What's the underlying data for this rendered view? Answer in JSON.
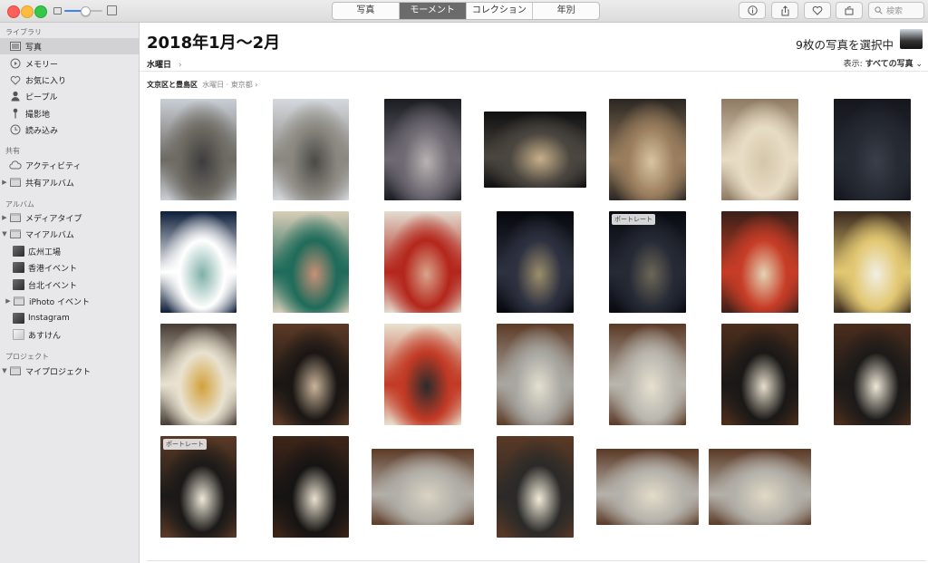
{
  "toolbar": {
    "tabs": [
      {
        "label": "写真",
        "active": false
      },
      {
        "label": "モーメント",
        "active": true
      },
      {
        "label": "コレクション",
        "active": false
      },
      {
        "label": "年別",
        "active": false
      }
    ],
    "search_placeholder": "検索",
    "zoom_level": 0.55,
    "buttons": [
      "info-icon",
      "share-icon",
      "heart-icon",
      "rotate-icon"
    ]
  },
  "sidebar": {
    "sections": [
      {
        "title": "ライブラリ",
        "items": [
          {
            "label": "写真",
            "icon": "photos-icon",
            "selected": true
          },
          {
            "label": "メモリー",
            "icon": "memories-icon"
          },
          {
            "label": "お気に入り",
            "icon": "heart-icon"
          },
          {
            "label": "ピープル",
            "icon": "person-icon"
          },
          {
            "label": "撮影地",
            "icon": "pin-icon"
          },
          {
            "label": "読み込み",
            "icon": "clock-icon"
          }
        ]
      },
      {
        "title": "共有",
        "items": [
          {
            "label": "アクティビティ",
            "icon": "cloud-icon"
          },
          {
            "label": "共有アルバム",
            "icon": "folder-icon",
            "expandable": true
          }
        ]
      },
      {
        "title": "アルバム",
        "items": [
          {
            "label": "メディアタイプ",
            "icon": "folder-icon",
            "expandable": true
          },
          {
            "label": "マイアルバム",
            "icon": "folder-icon",
            "expanded": true
          },
          {
            "label": "広州工場",
            "icon": "album-thumb"
          },
          {
            "label": "香港イベント",
            "icon": "album-thumb"
          },
          {
            "label": "台北イベント",
            "icon": "album-thumb"
          },
          {
            "label": "iPhoto イベント",
            "icon": "folder-icon",
            "expandable": true
          },
          {
            "label": "Instagram",
            "icon": "album-thumb"
          },
          {
            "label": "あすけん",
            "icon": "album-thumb-light"
          }
        ]
      },
      {
        "title": "プロジェクト",
        "items": [
          {
            "label": "マイプロジェクト",
            "icon": "folder-icon",
            "expanded": true
          }
        ]
      }
    ]
  },
  "main": {
    "title": "2018年1月～2月",
    "subtitle": "水曜日",
    "selection_text": "9枚の写真を選択中",
    "show_label": "表示:",
    "show_value": "すべての写真",
    "location": {
      "name": "文京区と豊島区",
      "day": "水曜日",
      "city": "東京都"
    }
  },
  "photos": [
    {
      "name": "street-trees-day",
      "colors": [
        "#c9cfd6",
        "#6e6a63",
        "#3d3d3d"
      ],
      "badge": ""
    },
    {
      "name": "street-road-day",
      "colors": [
        "#d5d9de",
        "#8a8780",
        "#4a4a46"
      ],
      "badge": ""
    },
    {
      "name": "city-night-crossing",
      "colors": [
        "#1a1c22",
        "#6f6a73",
        "#b8b2b2"
      ],
      "badge": ""
    },
    {
      "name": "cafe-storefront-sign",
      "colors": [
        "#0f0f10",
        "#4b4640",
        "#c7b08a"
      ],
      "badge": ""
    },
    {
      "name": "cafe-interior",
      "colors": [
        "#2a2622",
        "#9a7e5e",
        "#d9c4a0"
      ],
      "badge": ""
    },
    {
      "name": "menu-board-ofa",
      "colors": [
        "#8e7a62",
        "#e8dcc5",
        "#d4c6a8"
      ],
      "badge": ""
    },
    {
      "name": "dark-wall-logo",
      "colors": [
        "#15171d",
        "#262a33",
        "#3a3f4a"
      ],
      "badge": ""
    },
    {
      "name": "green-jar-product",
      "colors": [
        "#0d1e3a",
        "#ffffff",
        "#7fb0a8"
      ],
      "badge": ""
    },
    {
      "name": "green-bottle-hand",
      "colors": [
        "#d8cdb8",
        "#1f6b5a",
        "#c99077"
      ],
      "badge": ""
    },
    {
      "name": "red-bottle-hand",
      "colors": [
        "#e2dccf",
        "#b4261c",
        "#d9a48c"
      ],
      "badge": ""
    },
    {
      "name": "street-night-lights",
      "colors": [
        "#05070c",
        "#2e3140",
        "#9c8f6b"
      ],
      "badge": ""
    },
    {
      "name": "night-buildings-moon",
      "colors": [
        "#080a10",
        "#262a35",
        "#6d6758"
      ],
      "badge": "ポートレート"
    },
    {
      "name": "restaurant-sign-red",
      "colors": [
        "#3a2018",
        "#c73d27",
        "#e4d3b4"
      ],
      "badge": ""
    },
    {
      "name": "highball-glass",
      "colors": [
        "#3a2a1e",
        "#e2c873",
        "#f2efe4"
      ],
      "badge": ""
    },
    {
      "name": "drink-menu-card",
      "colors": [
        "#473c34",
        "#e9e2d0",
        "#d2a13c"
      ],
      "badge": ""
    },
    {
      "name": "hotpot-vegetables",
      "colors": [
        "#5c3a26",
        "#1a1614",
        "#c9b49a"
      ],
      "badge": ""
    },
    {
      "name": "menu-poster",
      "colors": [
        "#e8e2cf",
        "#c23a25",
        "#2b2b2b"
      ],
      "badge": ""
    },
    {
      "name": "hotpot-pan-table",
      "colors": [
        "#5c3b26",
        "#a9a7a2",
        "#e3dfd0"
      ],
      "badge": ""
    },
    {
      "name": "hotpot-pan-meat",
      "colors": [
        "#5a3926",
        "#b9b6ae",
        "#e6e0d0"
      ],
      "badge": ""
    },
    {
      "name": "soup-bowl-top",
      "colors": [
        "#4d2e1c",
        "#1a1817",
        "#e7dfcd"
      ],
      "badge": ""
    },
    {
      "name": "soup-bowl-black",
      "colors": [
        "#4a2d1c",
        "#1c1a19",
        "#efe8d8"
      ],
      "badge": ""
    },
    {
      "name": "soup-bowl-portrait",
      "colors": [
        "#5b3a26",
        "#1b1918",
        "#eee8d9"
      ],
      "badge": "ポートレート"
    },
    {
      "name": "chicken-in-soup",
      "colors": [
        "#3e2519",
        "#161413",
        "#e9e1cf"
      ],
      "badge": ""
    },
    {
      "name": "hotpot-pan-noodles",
      "colors": [
        "#5c3a26",
        "#b2afa8",
        "#d9d3c3"
      ],
      "badge": ""
    },
    {
      "name": "small-white-cup",
      "colors": [
        "#5a3925",
        "#2b2a28",
        "#f1ebda"
      ],
      "badge": ""
    },
    {
      "name": "hotpot-pan-empty",
      "colors": [
        "#5a3925",
        "#b5b2ab",
        "#e2dcc9"
      ],
      "badge": ""
    },
    {
      "name": "hotpot-pan-empty-2",
      "colors": [
        "#5a3925",
        "#b3b0a9",
        "#e0d9c5"
      ],
      "badge": ""
    }
  ]
}
